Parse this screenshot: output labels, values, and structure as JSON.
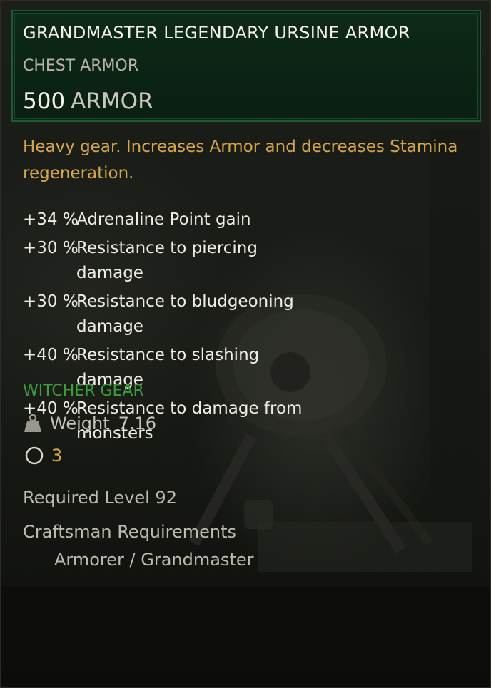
{
  "item": {
    "name": "GRANDMASTER LEGENDARY URSINE ARMOR",
    "type": "CHEST ARMOR",
    "armor_value": "500",
    "armor_label": "ARMOR",
    "description": "Heavy gear. Increases Armor and decreases Stamina regeneration.",
    "stats": [
      {
        "value": "+34 %",
        "label": "Adrenaline Point gain"
      },
      {
        "value": "+30 %",
        "label": "Resistance to piercing damage"
      },
      {
        "value": "+30 %",
        "label": "Resistance to bludgeoning damage"
      },
      {
        "value": "+40 %",
        "label": "Resistance to slashing damage"
      },
      {
        "value": "+40 %",
        "label": "Resistance to damage from monsters"
      }
    ],
    "set_label": "WITCHER GEAR",
    "weight_label": "Weight",
    "weight_value": "7.16",
    "slots_count": "3",
    "required_level": "Required Level 92",
    "craftsman_title": "Craftsman Requirements",
    "craftsman_value": "Armorer / Grandmaster"
  },
  "icons": {
    "weight": "weight-icon",
    "slot": "upgrade-slot-icon"
  },
  "colors": {
    "header_bg": "#0e2a18",
    "header_border": "#1f5a33",
    "description": "#d4a64c",
    "set_label": "#3c9b3c",
    "slot_count": "#d4a64c",
    "stat_text": "#eeece3"
  }
}
